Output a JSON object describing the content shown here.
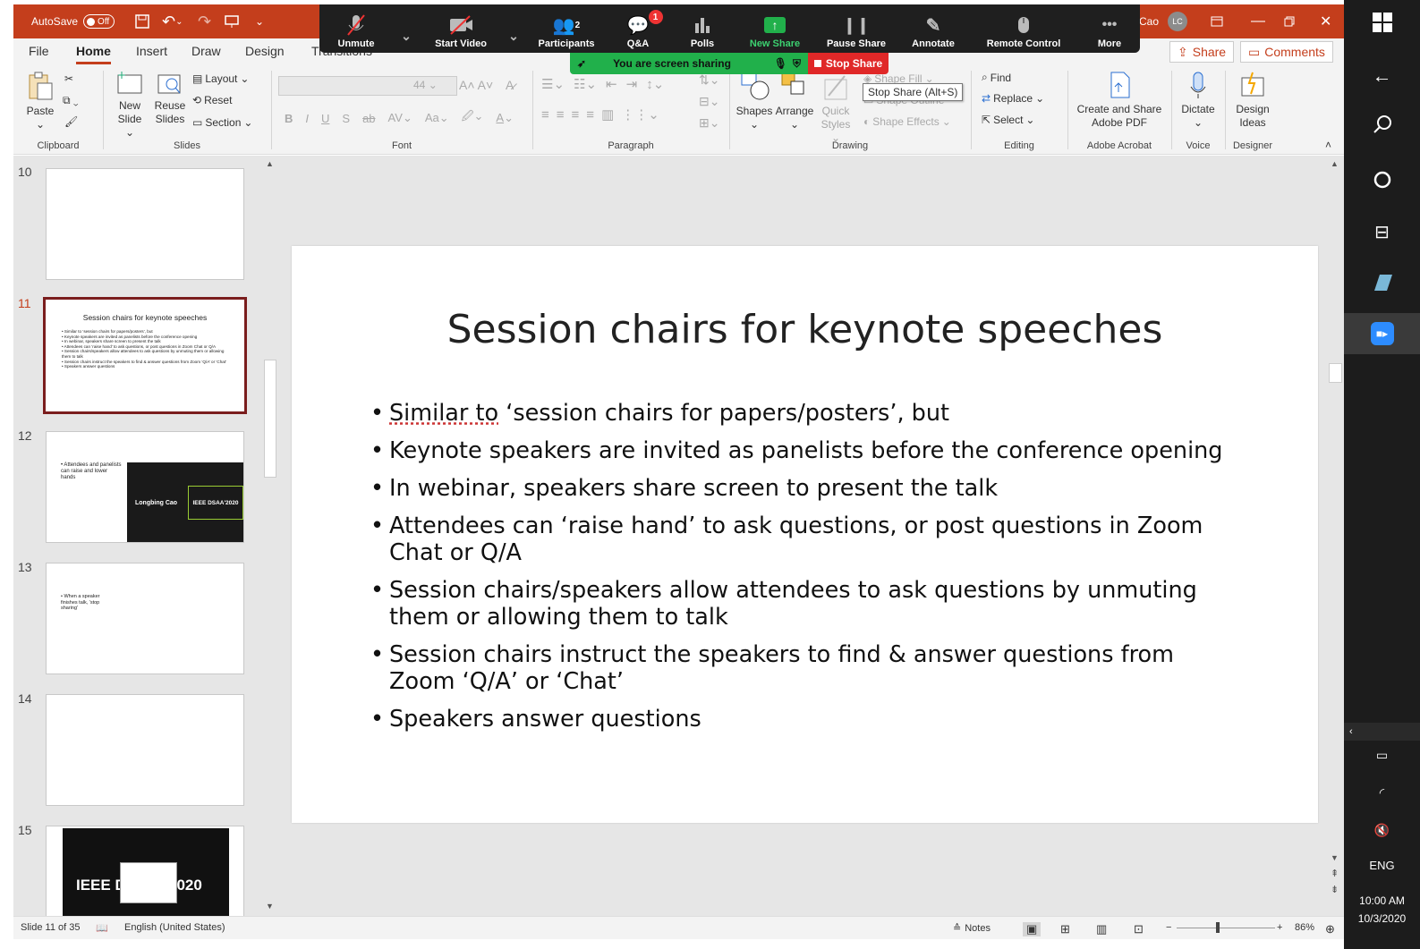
{
  "titlebar": {
    "autosave_label": "AutoSave",
    "autosave_state": "Off",
    "user_name": "Cao",
    "user_initials": "LC"
  },
  "tabs": [
    {
      "label": "File"
    },
    {
      "label": "Home"
    },
    {
      "label": "Insert"
    },
    {
      "label": "Draw"
    },
    {
      "label": "Design"
    },
    {
      "label": "Transitions"
    }
  ],
  "tab_buttons": {
    "share": "Share",
    "comments": "Comments"
  },
  "ribbon": {
    "clipboard": {
      "paste": "Paste",
      "group": "Clipboard"
    },
    "slides": {
      "new_slide_1": "New",
      "new_slide_2": "Slide",
      "reuse_1": "Reuse",
      "reuse_2": "Slides",
      "layout": "Layout",
      "reset": "Reset",
      "section": "Section",
      "group": "Slides"
    },
    "font": {
      "size": "44",
      "group": "Font",
      "b": "B",
      "i": "I",
      "u": "U",
      "s": "S",
      "abc": "ab",
      "av": "AV",
      "aa": "Aa",
      "a": "A"
    },
    "paragraph": {
      "group": "Paragraph"
    },
    "drawing": {
      "shapes": "Shapes",
      "arrange": "Arrange",
      "quick_1": "Quick",
      "quick_2": "Styles",
      "shape_fill": "Shape Fill",
      "shape_outline": "Shape Outline",
      "shape_effects": "Shape Effects",
      "group": "Drawing"
    },
    "editing": {
      "find": "Find",
      "replace": "Replace",
      "select": "Select",
      "group": "Editing"
    },
    "acrobat": {
      "label_1": "Create and Share",
      "label_2": "Adobe PDF",
      "group": "Adobe Acrobat"
    },
    "voice": {
      "dictate": "Dictate",
      "group": "Voice"
    },
    "designer": {
      "label_1": "Design",
      "label_2": "Ideas",
      "group": "Designer"
    }
  },
  "zoom": {
    "items": [
      {
        "label": "Unmute"
      },
      {
        "label": "Start Video"
      },
      {
        "label": "Participants",
        "count": "2"
      },
      {
        "label": "Q&A",
        "badge": "1"
      },
      {
        "label": "Polls"
      },
      {
        "label": "New Share"
      },
      {
        "label": "Pause Share"
      },
      {
        "label": "Annotate"
      },
      {
        "label": "Remote Control"
      },
      {
        "label": "More"
      }
    ],
    "sharing_text": "You are screen sharing",
    "stop_share": "Stop Share",
    "tooltip": "Stop Share (Alt+S)"
  },
  "thumbnails": [
    {
      "num": "10"
    },
    {
      "num": "11",
      "title": "Session chairs for keynote speeches"
    },
    {
      "num": "12",
      "text": "• Attendees and panelists can raise and lower hands",
      "name1": "Longbing Cao",
      "name2": "IEEE DSAA'2020"
    },
    {
      "num": "13",
      "text": "• When a speaker finishes talk, 'stop sharing'"
    },
    {
      "num": "14"
    },
    {
      "num": "15",
      "text": "IEEE D",
      "text2": "2020"
    }
  ],
  "slide": {
    "title": "Session chairs for keynote speeches",
    "bullets": [
      "Similar to ‘session chairs for papers/posters’, but",
      "Keynote speakers are invited as panelists before the conference opening",
      "In webinar, speakers share screen to present the talk",
      "Attendees can ‘raise hand’ to ask questions, or post questions in Zoom Chat or Q/A",
      "Session chairs/speakers allow attendees to ask questions by unmuting them or allowing them to talk",
      "Session chairs instruct the speakers to find & answer questions from Zoom ‘Q/A’ or ‘Chat’",
      "Speakers answer questions"
    ]
  },
  "status": {
    "slide_info": "Slide 11 of 35",
    "language": "English (United States)",
    "notes": "Notes",
    "zoom_level": "86%"
  },
  "taskbar": {
    "lang": "ENG",
    "time": "10:00 AM",
    "date": "10/3/2020"
  }
}
